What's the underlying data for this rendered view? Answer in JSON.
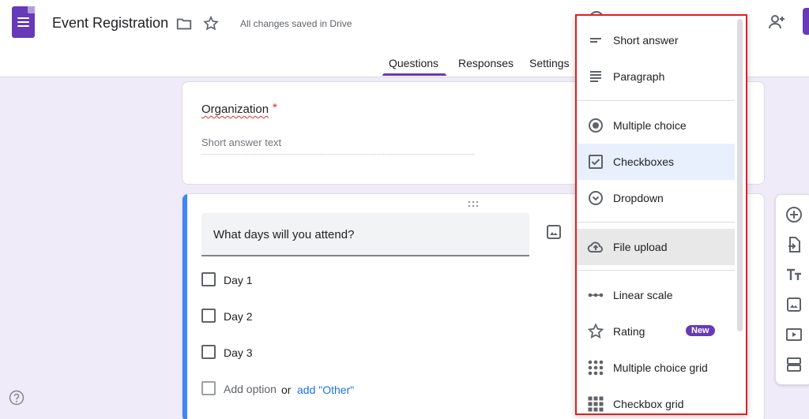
{
  "header": {
    "title": "Event Registration",
    "save_status": "All changes saved in Drive"
  },
  "tabs": [
    {
      "label": "Questions",
      "active": true
    },
    {
      "label": "Responses",
      "active": false
    },
    {
      "label": "Settings",
      "active": false
    }
  ],
  "question1": {
    "title": "Organization",
    "required_mark": "*",
    "placeholder": "Short answer text"
  },
  "question2": {
    "title": "What days will you attend?",
    "options": [
      "Day 1",
      "Day 2",
      "Day 3"
    ],
    "add_option": "Add option",
    "or": "or",
    "add_other": "add \"Other\""
  },
  "menu": {
    "items": [
      {
        "label": "Short answer",
        "icon": "short-answer-icon"
      },
      {
        "label": "Paragraph",
        "icon": "paragraph-icon"
      },
      {
        "label": "Multiple choice",
        "icon": "radio-icon"
      },
      {
        "label": "Checkboxes",
        "icon": "checkbox-icon"
      },
      {
        "label": "Dropdown",
        "icon": "dropdown-icon"
      },
      {
        "label": "File upload",
        "icon": "cloud-upload-icon"
      },
      {
        "label": "Linear scale",
        "icon": "linear-scale-icon"
      },
      {
        "label": "Rating",
        "icon": "star-icon"
      },
      {
        "label": "Multiple choice grid",
        "icon": "grid-dots-icon"
      },
      {
        "label": "Checkbox grid",
        "icon": "grid-squares-icon"
      }
    ],
    "new_badge": "New"
  },
  "colors": {
    "accent": "#673ab7",
    "background": "#f0ebf8",
    "question_active": "#4285f4",
    "highlight_border": "#e02020",
    "link": "#1a73e8"
  }
}
